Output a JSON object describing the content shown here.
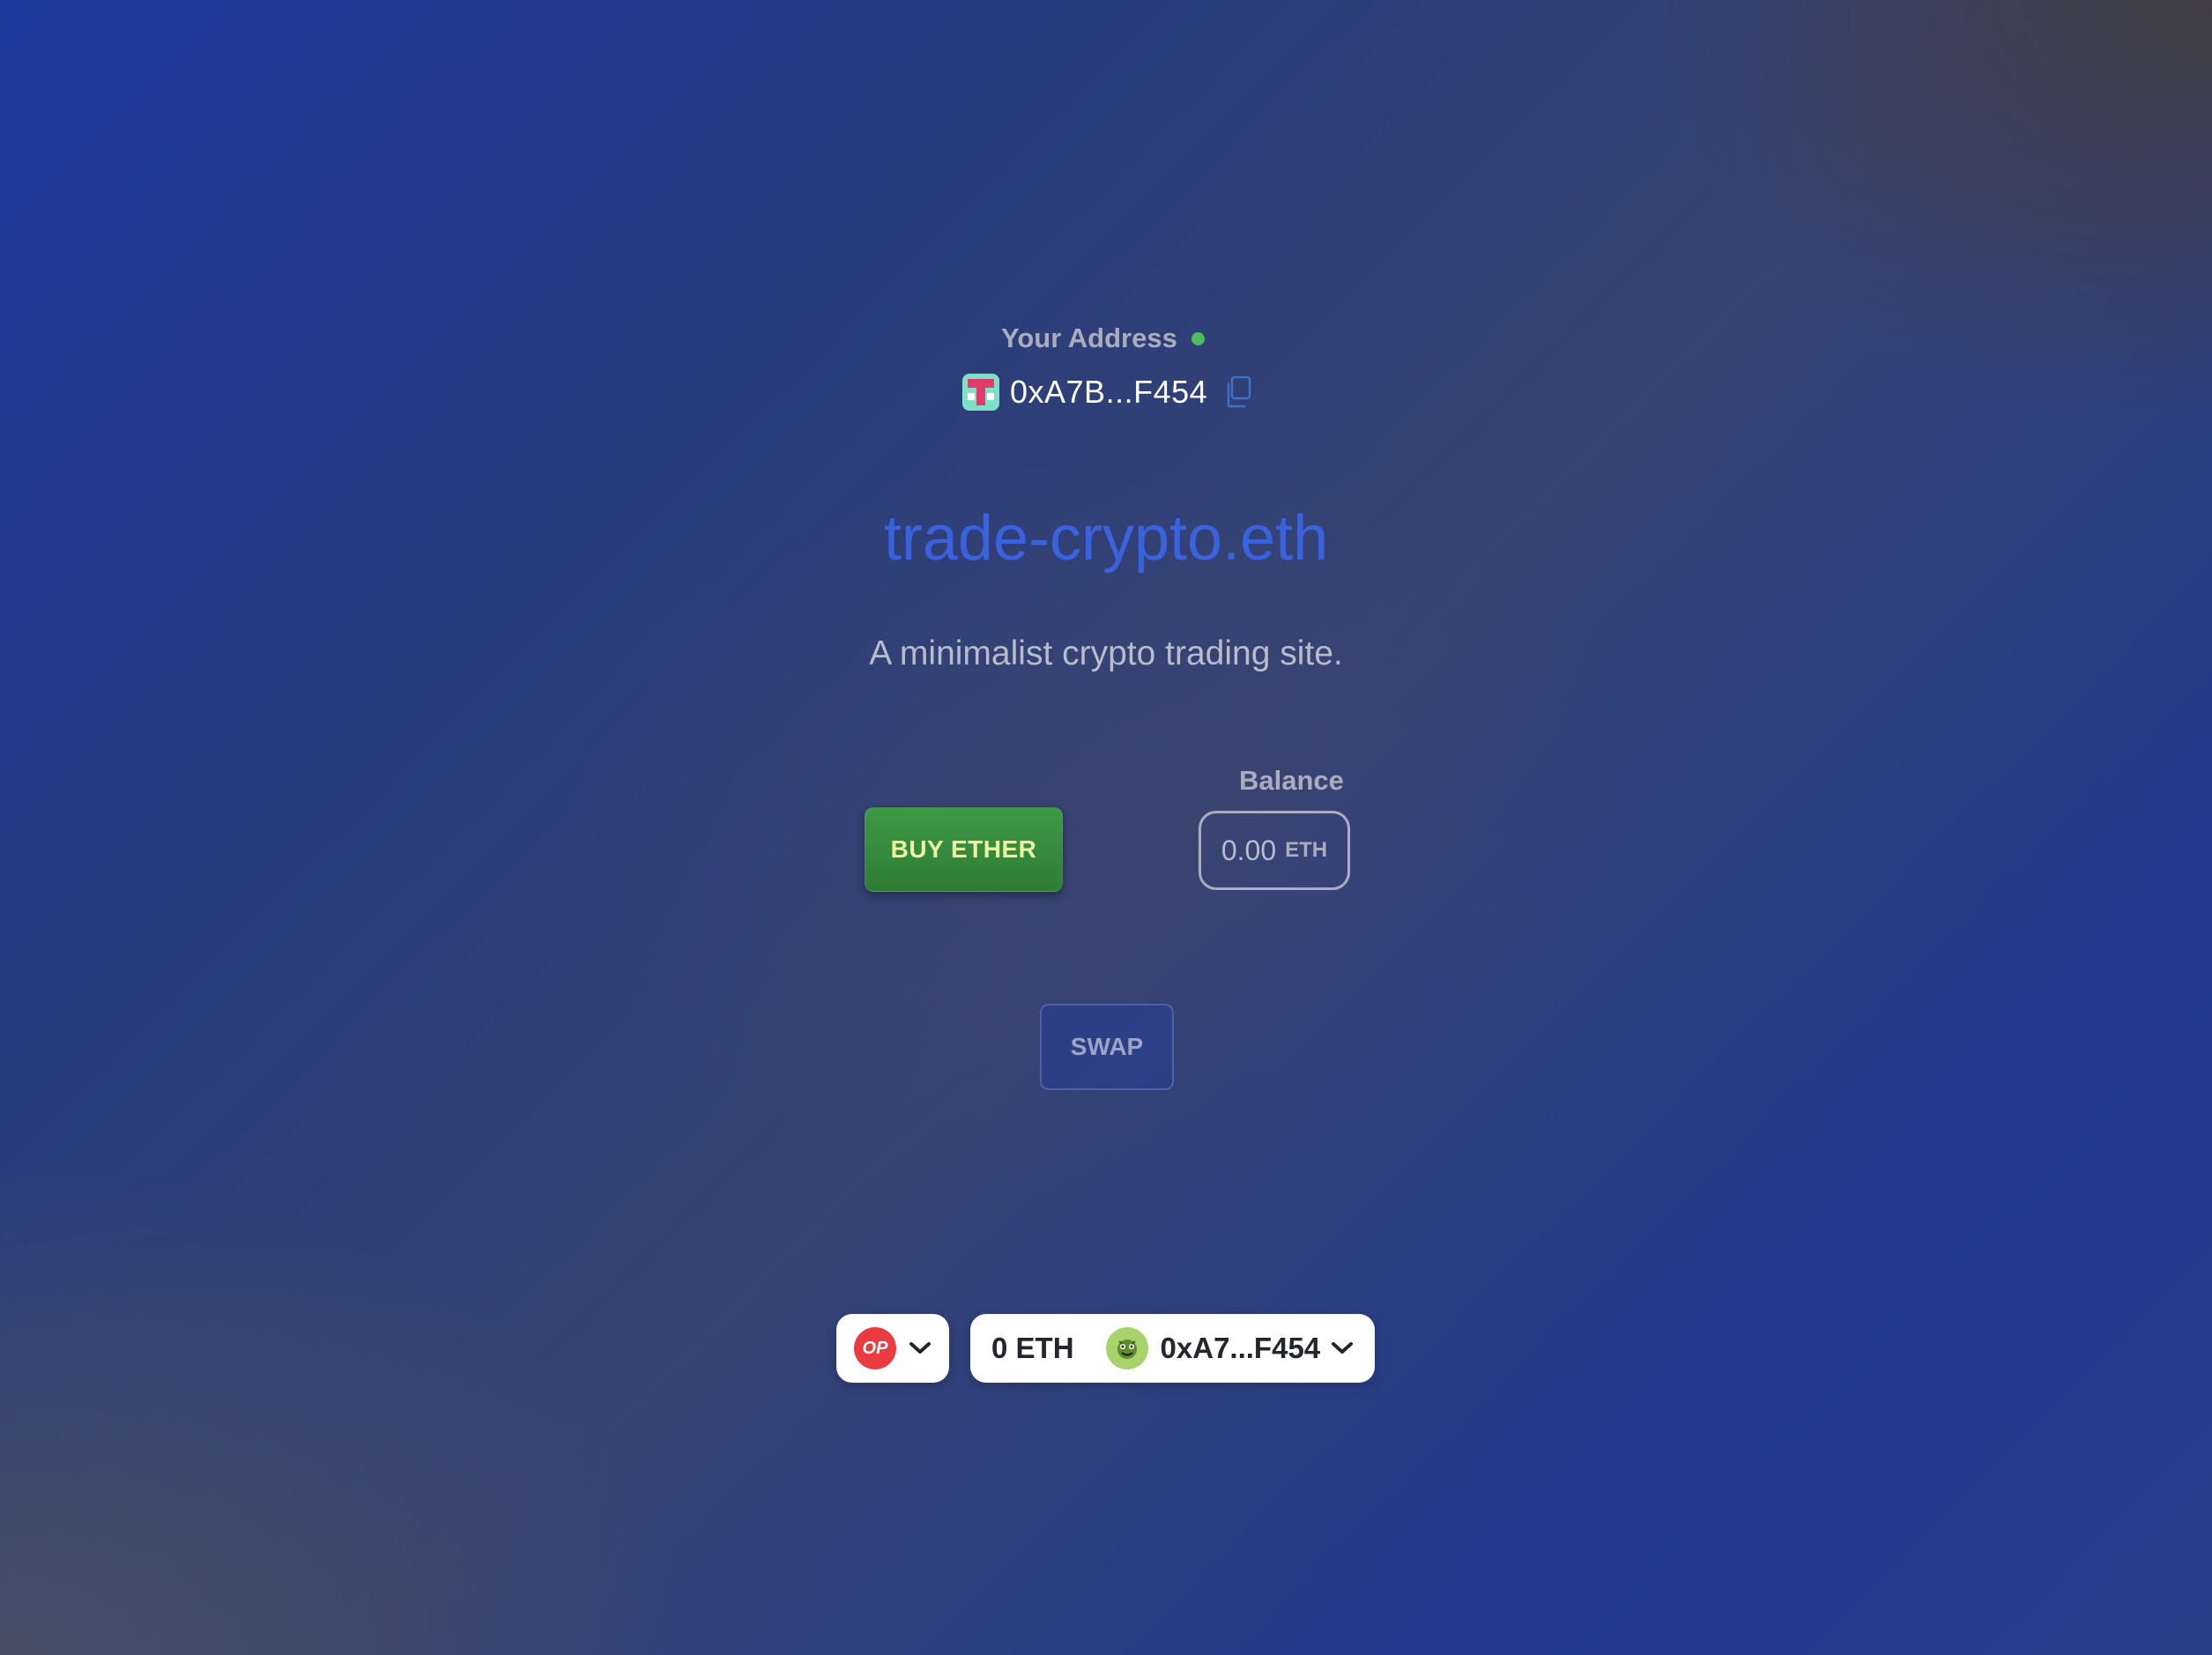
{
  "wallet": {
    "address_label": "Your Address",
    "address_short": "0xA7B...F454",
    "status_color": "#4cbe5e"
  },
  "hero": {
    "title": "trade-crypto.eth",
    "subtitle": "A minimalist crypto trading site."
  },
  "actions": {
    "buy_label": "BUY ETHER",
    "swap_label": "SWAP"
  },
  "balance": {
    "label": "Balance",
    "value": "0.00",
    "unit": "ETH"
  },
  "connect": {
    "network_badge": "OP",
    "eth_balance": "0 ETH",
    "account_address": "0xA7...F454"
  },
  "colors": {
    "title_accent": "#3a62dc",
    "buy_button": "#3d9a45",
    "buy_text": "#e7f5a4",
    "op_red": "#ea3b41"
  },
  "icons": {
    "copy": "copy-icon",
    "status": "status-dot",
    "chevron": "chevron-down-icon"
  }
}
